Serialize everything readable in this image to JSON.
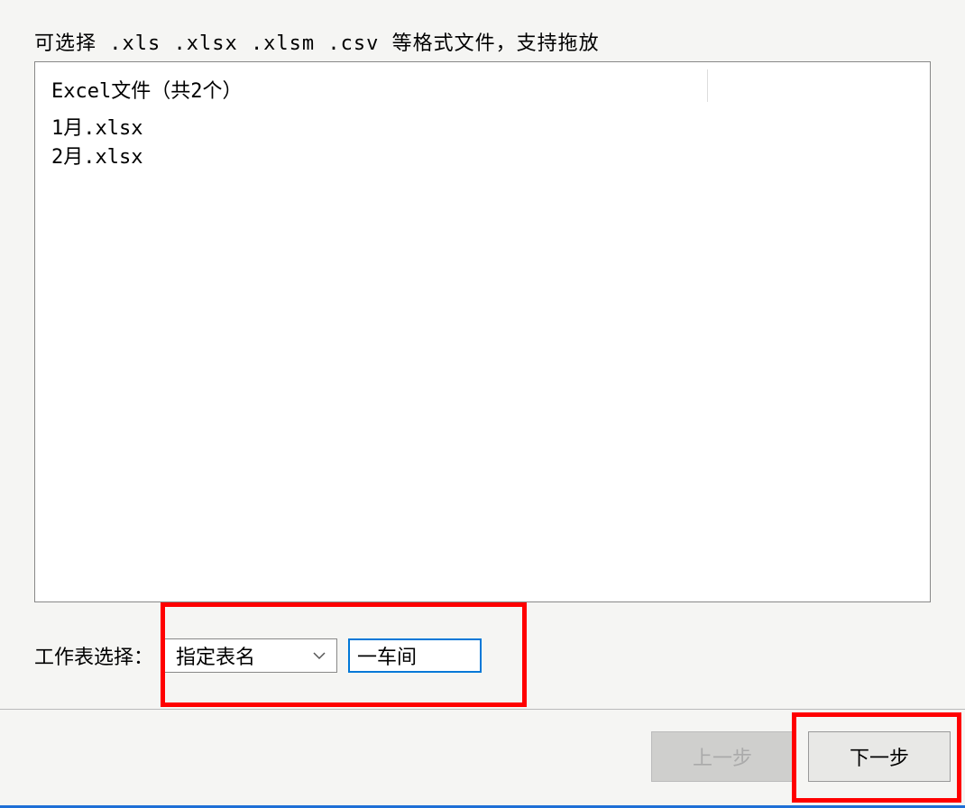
{
  "instruction": "可选择 .xls  .xlsx  .xlsm .csv 等格式文件，支持拖放",
  "file_list": {
    "header": "Excel文件（共2个）",
    "items": [
      "1月.xlsx",
      "2月.xlsx"
    ]
  },
  "sheet_select": {
    "label": "工作表选择：",
    "dropdown_value": "指定表名",
    "input_value": "一车间"
  },
  "buttons": {
    "prev": "上一步",
    "next": "下一步"
  }
}
